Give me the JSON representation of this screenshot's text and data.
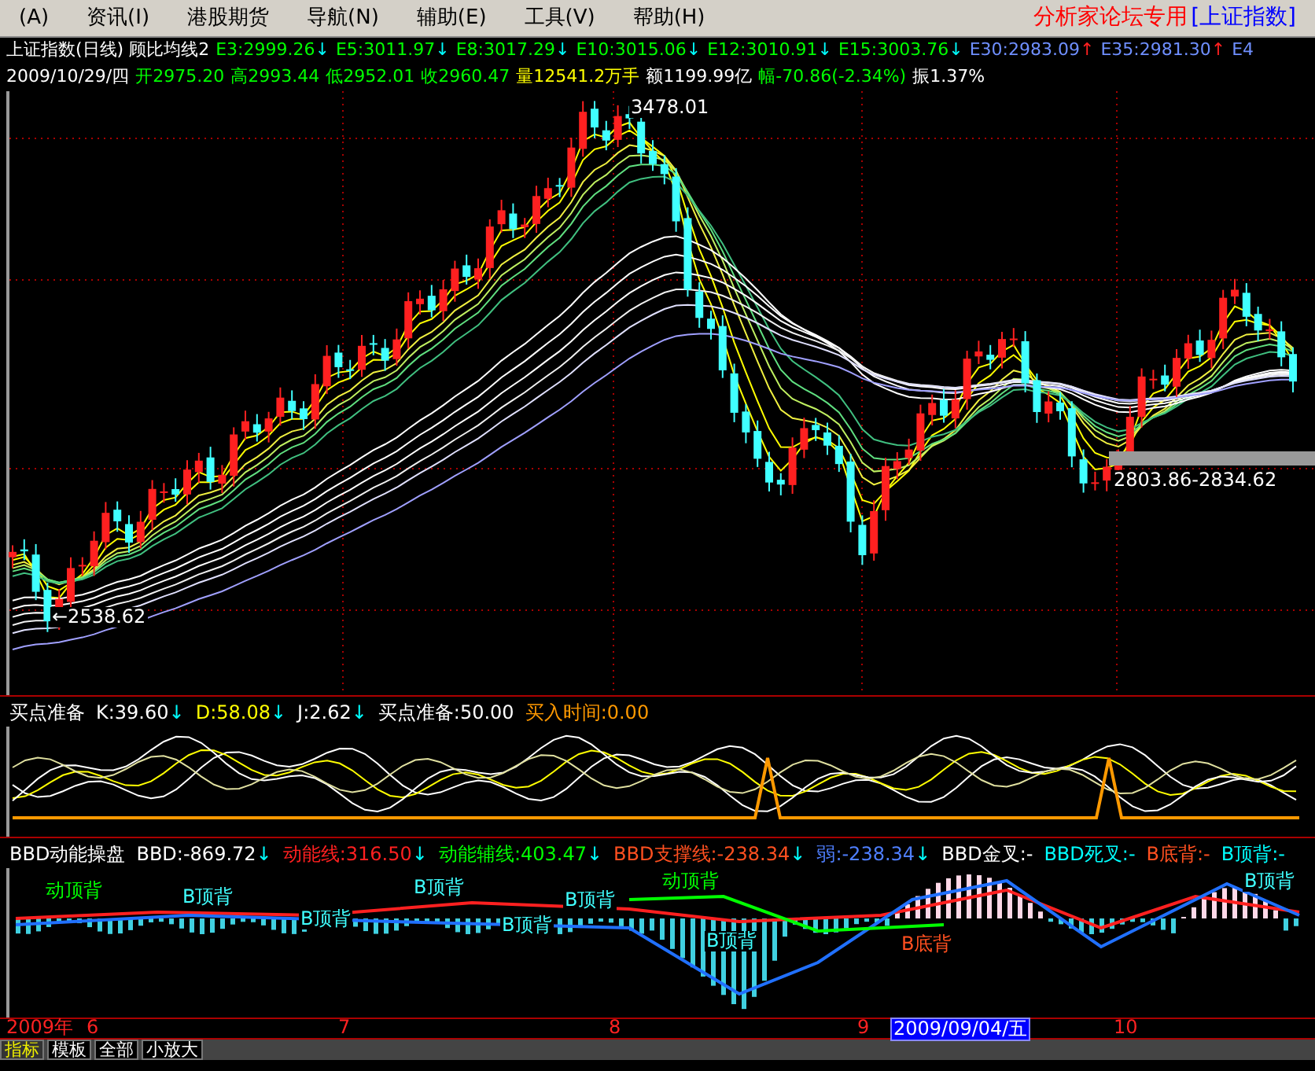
{
  "menu": {
    "items": [
      {
        "label": "(A)"
      },
      {
        "label": "资讯(I)"
      },
      {
        "label": "港股期货"
      },
      {
        "label": "导航(N)"
      },
      {
        "label": "辅助(E)"
      },
      {
        "label": "工具(V)"
      },
      {
        "label": "帮助(H)"
      }
    ],
    "brand": "分析家论坛专用",
    "index_name": "[上证指数]"
  },
  "quote_header": {
    "title": "上证指数(日线) 顾比均线2",
    "averages": [
      {
        "text": "E3:2999.26",
        "color": "#00ff00",
        "arrow": {
          "text": "↓",
          "color": "#00ffff"
        }
      },
      {
        "text": "E5:3011.97",
        "color": "#00ff00",
        "arrow": {
          "text": "↓",
          "color": "#00ffff"
        }
      },
      {
        "text": "E8:3017.29",
        "color": "#00ff00",
        "arrow": {
          "text": "↓",
          "color": "#00ffff"
        }
      },
      {
        "text": "E10:3015.06",
        "color": "#00ff00",
        "arrow": {
          "text": "↓",
          "color": "#00ffff"
        }
      },
      {
        "text": "E12:3010.91",
        "color": "#00ff00",
        "arrow": {
          "text": "↓",
          "color": "#00ffff"
        }
      },
      {
        "text": "E15:3003.76",
        "color": "#00ff00",
        "arrow": {
          "text": "↓",
          "color": "#00ffff"
        }
      },
      {
        "text": "E30:2983.09",
        "color": "#6f8fff",
        "arrow": {
          "text": "↑",
          "color": "#ff2020"
        }
      },
      {
        "text": "E35:2981.30",
        "color": "#6f8fff",
        "arrow": {
          "text": "↑",
          "color": "#ff2020"
        }
      },
      {
        "text": "E4",
        "color": "#6f8fff"
      }
    ]
  },
  "quote_line": [
    {
      "text": "2009/10/29/四",
      "color": "#ffffff"
    },
    {
      "text": "开2975.20",
      "color": "#00ff00"
    },
    {
      "text": "高2993.44",
      "color": "#00ff00"
    },
    {
      "text": "低2952.01",
      "color": "#00ff00"
    },
    {
      "text": "收2960.47",
      "color": "#00ff00"
    },
    {
      "text": "量12541.2万手",
      "color": "#ffff00"
    },
    {
      "text": "额1199.99亿",
      "color": "#ffffff"
    },
    {
      "text": "幅-70.86(-2.34%)",
      "color": "#00ff00"
    },
    {
      "text": "振1.37%",
      "color": "#ffffff"
    }
  ],
  "main_chart": {
    "labels": [
      {
        "text": "3478.01",
        "kind": "high"
      },
      {
        "text": "2803.86-2834.62",
        "kind": "range"
      },
      {
        "text": "←2538.62",
        "kind": "low"
      }
    ]
  },
  "kdj_panel": {
    "title": "买点准备",
    "values": [
      {
        "text": "K:39.60",
        "color": "#ffffff",
        "arrow": {
          "text": "↓",
          "color": "#00ffff"
        }
      },
      {
        "text": "D:58.08",
        "color": "#ffff00",
        "arrow": {
          "text": "↓",
          "color": "#00ffff"
        }
      },
      {
        "text": "J:2.62",
        "color": "#ffffff",
        "arrow": {
          "text": "↓",
          "color": "#00ffff"
        }
      },
      {
        "text": "买点准备:50.00",
        "color": "#ffffff"
      },
      {
        "text": "买入时间:0.00",
        "color": "#ff9900"
      }
    ]
  },
  "bbd_panel": {
    "title": "BBD动能操盘",
    "values": [
      {
        "text": "BBD:-869.72",
        "color": "#ffffff",
        "arrow": {
          "text": "↓",
          "color": "#00ffff"
        }
      },
      {
        "text": "动能线:316.50",
        "color": "#ff2020",
        "arrow": {
          "text": "↓",
          "color": "#00ffff"
        }
      },
      {
        "text": "动能辅线:403.47",
        "color": "#00ff00",
        "arrow": {
          "text": "↓",
          "color": "#00ffff"
        }
      },
      {
        "text": "BBD支撑线:-238.34",
        "color": "#ff5020",
        "arrow": {
          "text": "↓",
          "color": "#00ffff"
        }
      },
      {
        "text": "弱:-238.34",
        "color": "#4f7fff",
        "arrow": {
          "text": "↓",
          "color": "#00ffff"
        }
      },
      {
        "text": "BBD金叉:-",
        "color": "#ffffff"
      },
      {
        "text": "BBD死叉:-",
        "color": "#00ffff"
      },
      {
        "text": "B底背:-",
        "color": "#ff5020"
      },
      {
        "text": "B顶背:-",
        "color": "#00ffff"
      }
    ],
    "signals": [
      {
        "text": "动顶背",
        "kind": "momentum-top"
      },
      {
        "text": "B顶背",
        "kind": "b-top"
      },
      {
        "text": "B顶背",
        "kind": "b-top"
      },
      {
        "text": "B顶背",
        "kind": "b-top"
      },
      {
        "text": "B顶背",
        "kind": "b-top"
      },
      {
        "text": "B顶背",
        "kind": "b-top"
      },
      {
        "text": "动顶背",
        "kind": "momentum-top"
      },
      {
        "text": "B顶背",
        "kind": "b-top"
      },
      {
        "text": "B底背",
        "kind": "b-bottom"
      },
      {
        "text": "B顶背",
        "kind": "b-top"
      }
    ]
  },
  "time_axis": {
    "labels": [
      {
        "text": "2009年",
        "selected": false
      },
      {
        "text": "6",
        "selected": false
      },
      {
        "text": "7",
        "selected": false
      },
      {
        "text": "8",
        "selected": false
      },
      {
        "text": "9",
        "selected": false
      },
      {
        "text": "2009/09/04/五",
        "selected": true
      },
      {
        "text": "10",
        "selected": false
      }
    ]
  },
  "bottom_tabs": [
    {
      "label": "指标",
      "selected": true
    },
    {
      "label": "模板",
      "selected": false
    },
    {
      "label": "全部",
      "selected": false
    },
    {
      "label": "小放大",
      "selected": false
    }
  ]
}
